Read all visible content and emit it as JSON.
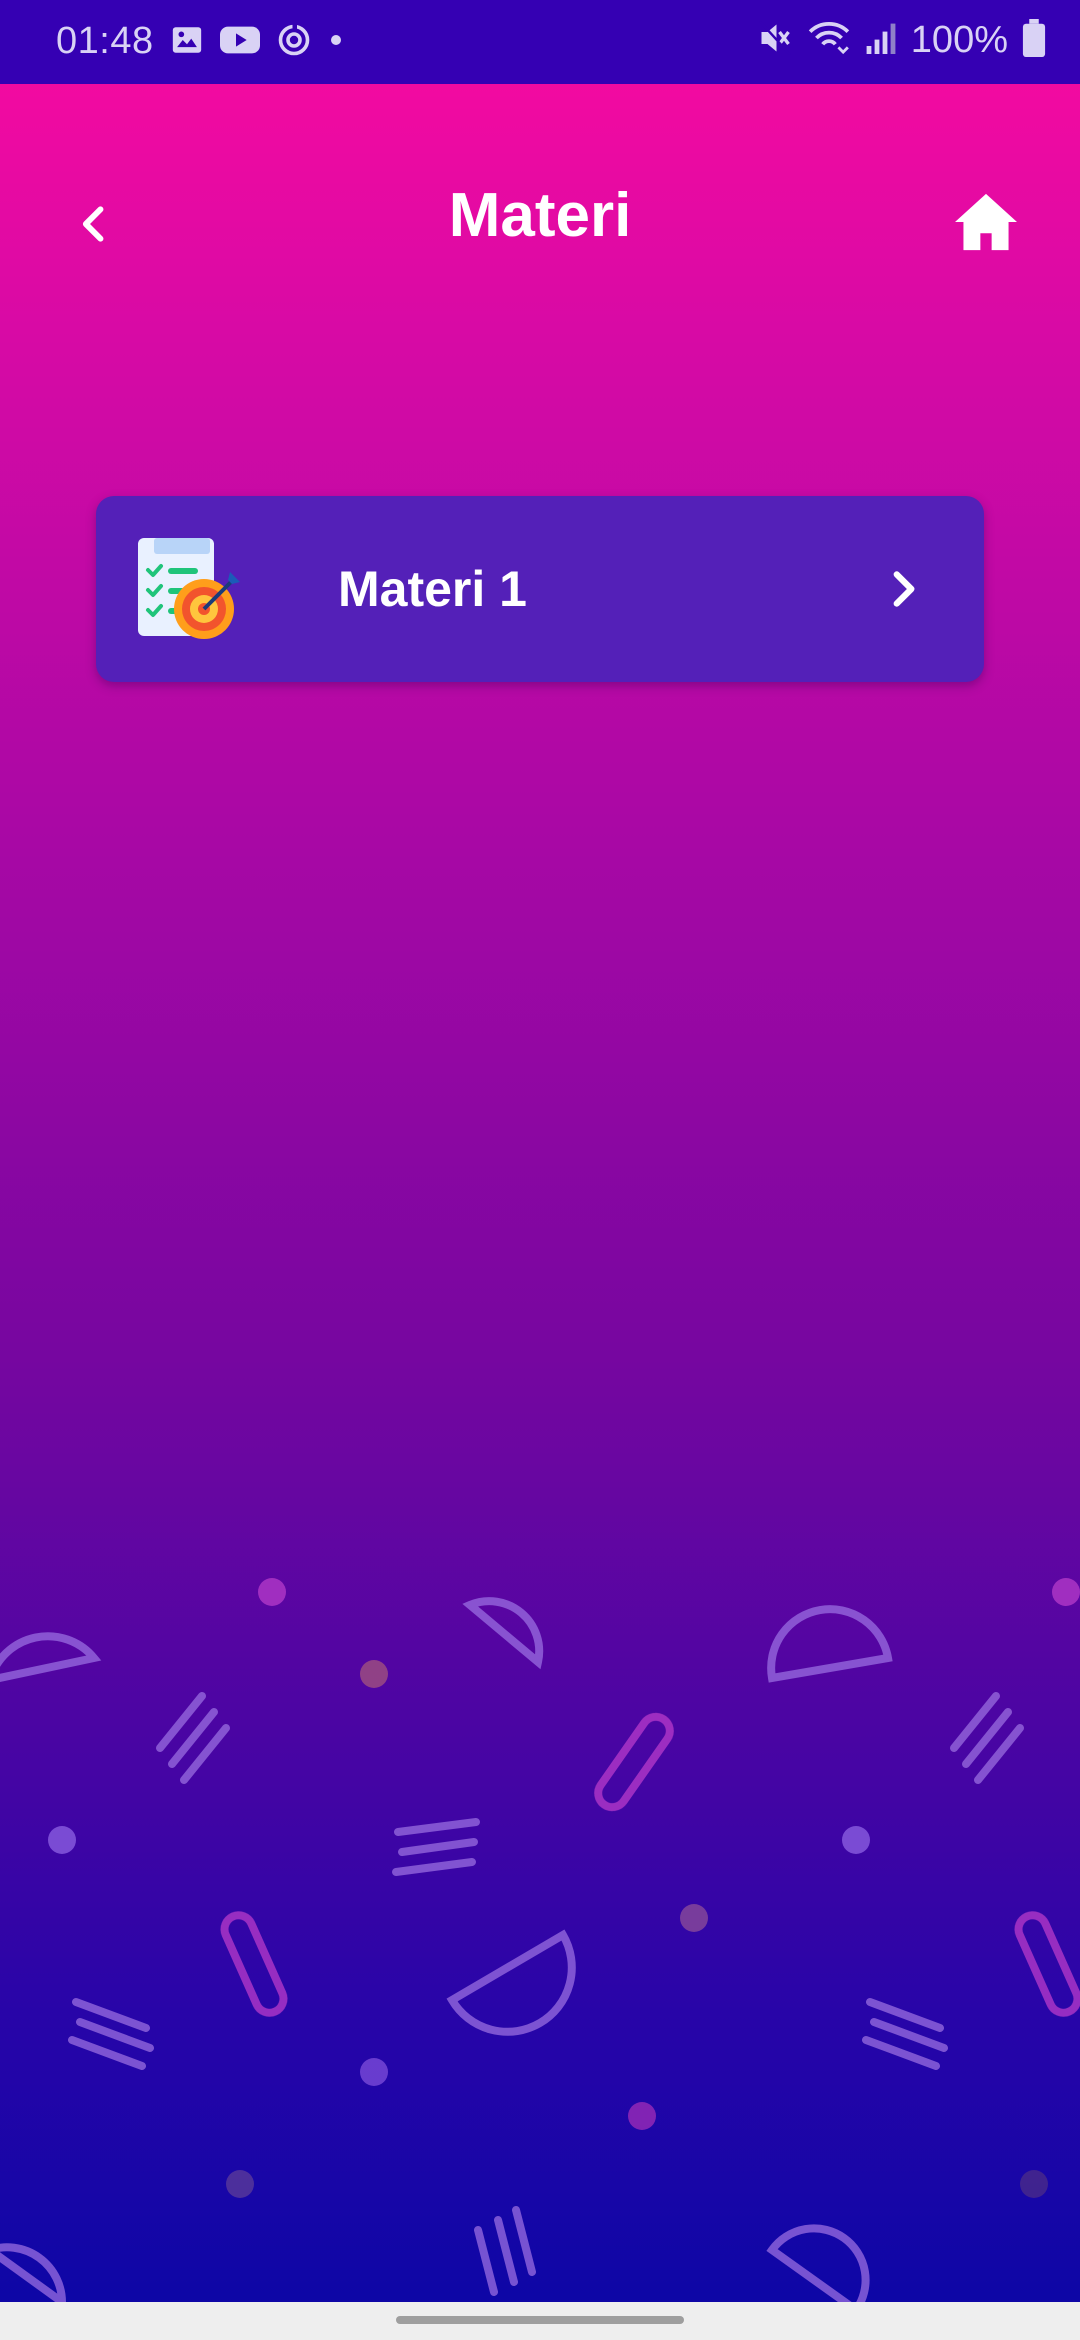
{
  "status_bar": {
    "time": "01:48",
    "left_icons": [
      "image-icon",
      "youtube-icon",
      "sync-icon",
      "dot-icon"
    ],
    "right_icons": [
      "mute-icon",
      "wifi-icon",
      "signal-icon",
      "battery-icon"
    ],
    "battery": "100%"
  },
  "header": {
    "title": "Materi",
    "back_icon": "chevron-left-icon",
    "home_icon": "home-icon"
  },
  "list": {
    "items": [
      {
        "label": "Materi 1",
        "icon": "checklist-target-icon",
        "chevron": "chevron-right-icon"
      }
    ]
  },
  "colors": {
    "status_bar": "#3500b3",
    "gradient_top": "#fb0a9f",
    "gradient_bottom": "#0a06a6",
    "card": "#5420b8",
    "text": "#ffffff",
    "decor": "#9a6de0"
  }
}
